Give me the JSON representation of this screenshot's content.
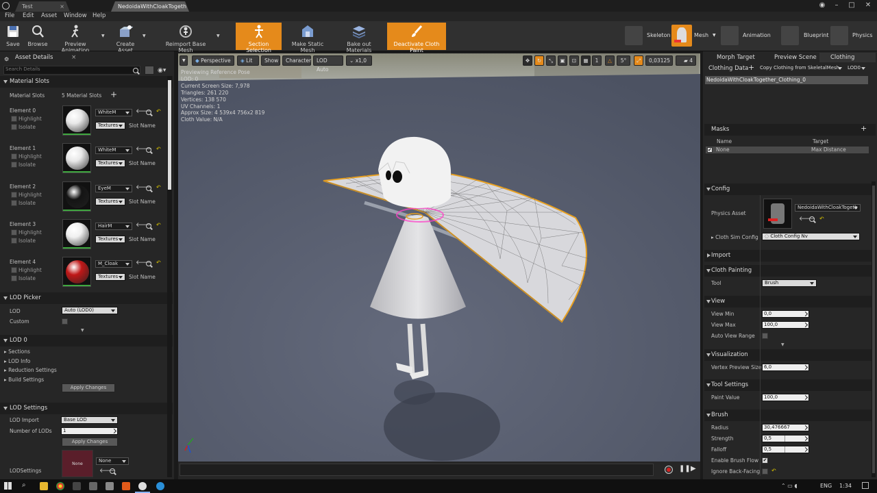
{
  "tabs": [
    {
      "label": "Test"
    },
    {
      "label": "NedoidaWithCloakTogeth"
    }
  ],
  "menu": [
    "File",
    "Edit",
    "Asset",
    "Window",
    "Help"
  ],
  "toolbar": {
    "save": "Save",
    "browse": "Browse",
    "preview_animation": "Preview Animation",
    "create_asset": "Create Asset",
    "reimport": "Reimport Base Mesh",
    "section_selection": "Section Selection",
    "make_static": "Make Static Mesh",
    "bake_out": "Bake out Materials",
    "deactivate_cloth": "Deactivate Cloth Paint"
  },
  "modes": {
    "skeleton": "Skeleton",
    "mesh": "Mesh",
    "animation": "Animation",
    "blueprint": "Blueprint",
    "physics": "Physics"
  },
  "left": {
    "tab": "Asset Details",
    "search_placeholder": "Search Details",
    "material_slots_header": "Material Slots",
    "material_slots_label": "Material Slots",
    "material_slots_count": "5 Material Slots",
    "elements": [
      {
        "name": "Element 0",
        "material": "WhiteM",
        "color": "#e8e8e8"
      },
      {
        "name": "Element 1",
        "material": "WhiteM",
        "color": "#e8e8e8"
      },
      {
        "name": "Element 2",
        "material": "EyeM",
        "color": "#141414"
      },
      {
        "name": "Element 3",
        "material": "HairM",
        "color": "#f0f0f0"
      },
      {
        "name": "Element 4",
        "material": "M_Cloak",
        "color": "#c01818"
      }
    ],
    "highlight": "Highlight",
    "isolate": "Isolate",
    "textures": "Textures",
    "slot_name": "Slot Name",
    "lod_picker_header": "LOD Picker",
    "lod_label": "LOD",
    "lod_value": "Auto (LOD0)",
    "custom_label": "Custom",
    "lod0_header": "LOD 0",
    "lod0_items": [
      "Sections",
      "LOD Info",
      "Reduction Settings",
      "Build Settings"
    ],
    "apply_changes": "Apply Changes",
    "lod_settings_header": "LOD Settings",
    "lod_import_label": "LOD Import",
    "lod_import_value": "Base LOD",
    "num_lods_label": "Number of LODs",
    "num_lods_value": "1",
    "lodsettings_label": "LODSettings",
    "none": "None"
  },
  "viewport": {
    "perspective": "Perspective",
    "lit": "Lit",
    "show": "Show",
    "character": "Character",
    "lod_auto": "LOD Auto",
    "speed": "x1,0",
    "info": [
      "Previewing Reference Pose",
      "LOD: 0",
      "Current Screen Size: 7,978",
      "Triangles: 261 220",
      "Vertices: 138 570",
      "UV Channels: 1",
      "Approx Size: 4 539x4 756x2 819",
      "Cloth Value: N/A"
    ],
    "grid": "1",
    "angle": "5°",
    "scale": "0,03125",
    "cam_speed": "4"
  },
  "right": {
    "tabs": [
      "Morph Target",
      "Preview Scene",
      "Clothing"
    ],
    "clothing_data": "Clothing Data",
    "copy_clothing": "Copy Clothing from SkeletalMesh",
    "lod": "LOD0",
    "clothing_item": "NedoidaWithCloakTogether_Clothing_0",
    "masks": "Masks",
    "col_name": "Name",
    "col_target": "Target",
    "mask_name": "None",
    "mask_target": "Max Distance",
    "config": "Config",
    "physics_asset_label": "Physics Asset",
    "physics_asset_value": "NedoidaWithCloakTogeth",
    "cloth_sim_label": "Cloth Sim Config",
    "cloth_sim_value": "Cloth Config Nv",
    "import": "Import",
    "cloth_painting": "Cloth Painting",
    "tool_label": "Tool",
    "tool_value": "Brush",
    "view": "View",
    "view_min_label": "View Min",
    "view_min": "0,0",
    "view_max_label": "View Max",
    "view_max": "100,0",
    "auto_view": "Auto View Range",
    "visualization": "Visualization",
    "vertex_size_label": "Vertex Preview Size",
    "vertex_size": "6,0",
    "tool_settings": "Tool Settings",
    "paint_value_label": "Paint Value",
    "paint_value": "100,0",
    "brush": "Brush",
    "radius_label": "Radius",
    "radius": "30,476667",
    "strength_label": "Strength",
    "strength": "0,5",
    "falloff_label": "Falloff",
    "falloff": "0,5",
    "enable_flow": "Enable Brush Flow",
    "ignore_back": "Ignore Back-Facing"
  },
  "taskbar": {
    "lang": "ENG",
    "time": "1:34"
  },
  "colors": {
    "accent": "#e58a1b",
    "panel": "#262626",
    "viewport": "#5a6070",
    "cloak_edge": "#e8a020"
  }
}
